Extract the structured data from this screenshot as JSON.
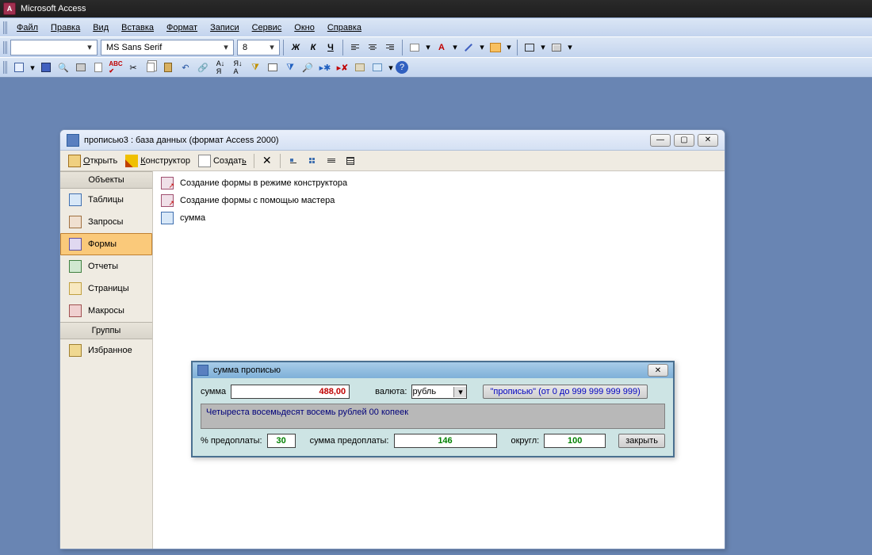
{
  "app": {
    "title": "Microsoft Access"
  },
  "menu": [
    "Файл",
    "Правка",
    "Вид",
    "Вставка",
    "Формат",
    "Записи",
    "Сервис",
    "Окно",
    "Справка"
  ],
  "format_toolbar": {
    "style": " ",
    "font": "MS Sans Serif",
    "size": "8"
  },
  "dbwin": {
    "title": "прописью3 : база данных (формат Access 2000)",
    "toolbar": {
      "open": "Открыть",
      "design": "Конструктор",
      "new": "Создать"
    },
    "sidebar": {
      "objects_header": "Объекты",
      "items": [
        {
          "label": "Таблицы"
        },
        {
          "label": "Запросы"
        },
        {
          "label": "Формы"
        },
        {
          "label": "Отчеты"
        },
        {
          "label": "Страницы"
        },
        {
          "label": "Макросы"
        }
      ],
      "groups_header": "Группы",
      "favorites": "Избранное"
    },
    "list": {
      "create_design": "Создание формы в режиме конструктора",
      "create_wizard": "Создание формы с помощью мастера",
      "item1": "сумма"
    }
  },
  "form": {
    "title": "сумма прописью",
    "sum_label": "сумма",
    "sum_value": "488,00",
    "currency_label": "валюта:",
    "currency_value": "рубль",
    "btn_propis": "\"прописью\" (от 0 до 999 999 999 999)",
    "result": "Четыреста восемьдесят восемь рублей 00 копеек",
    "prepay_pct_label": "% предоплаты:",
    "prepay_pct": "30",
    "prepay_sum_label": "сумма предоплаты:",
    "prepay_sum": "146",
    "round_label": "округл:",
    "round_value": "100",
    "close": "закрыть"
  }
}
